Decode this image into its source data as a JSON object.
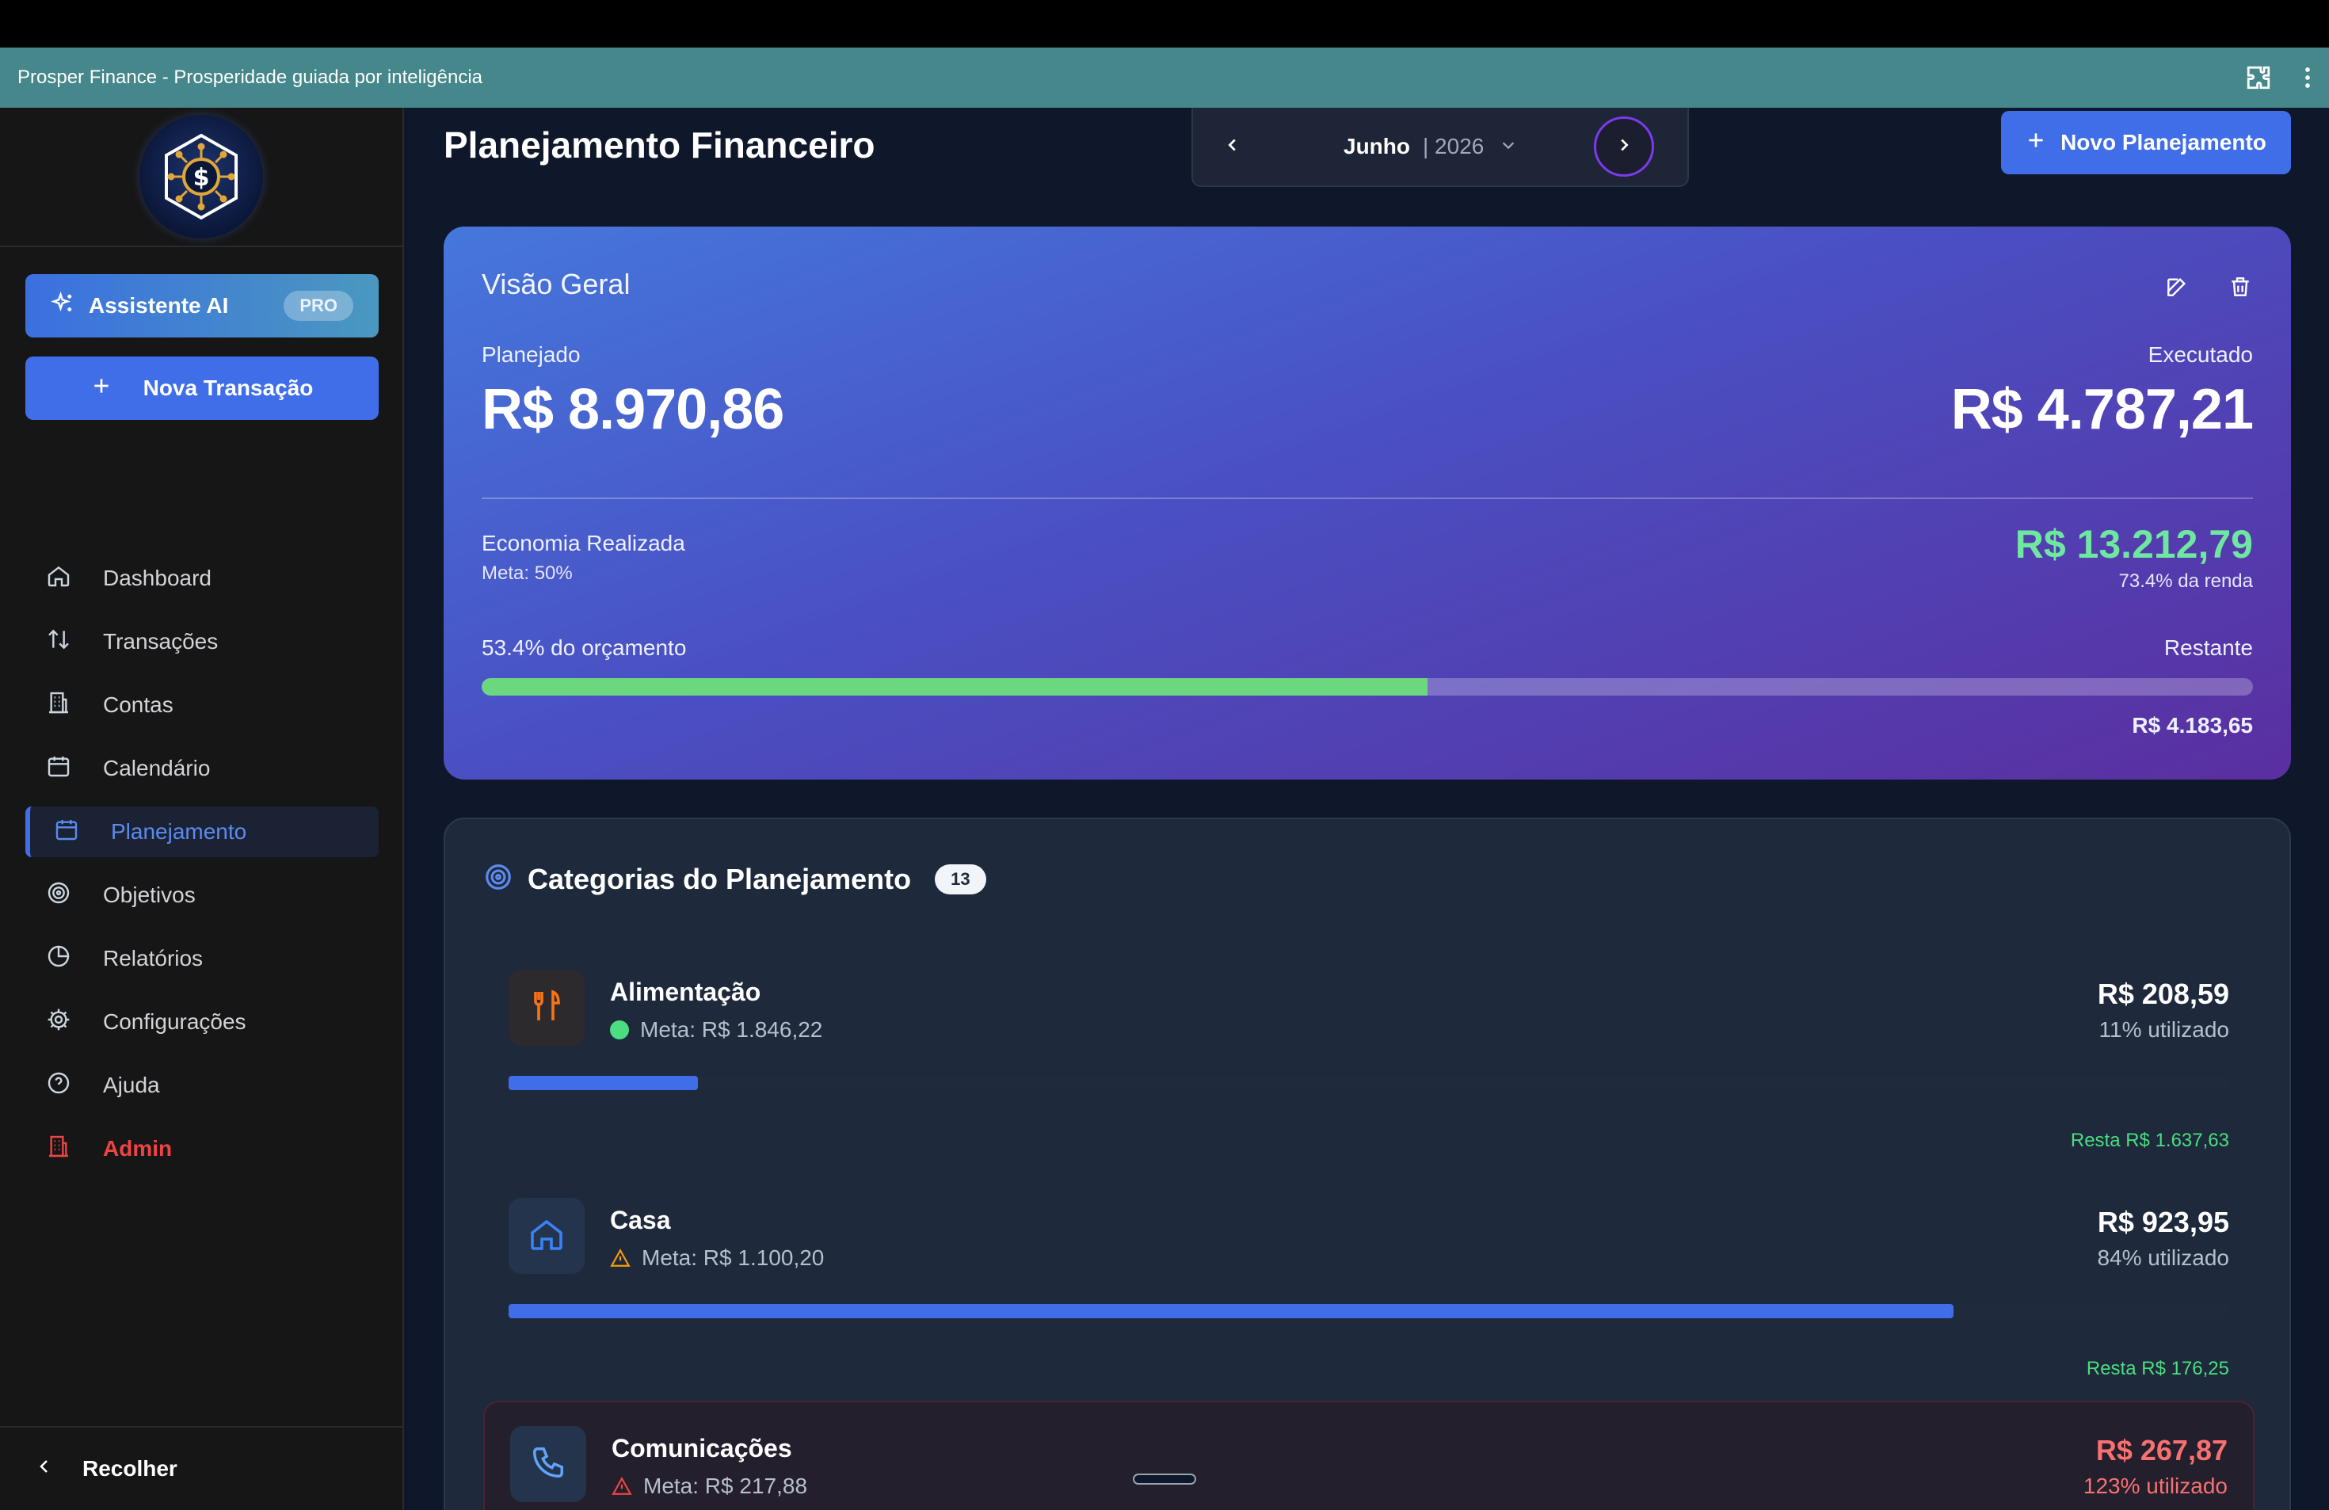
{
  "app": {
    "window_title": "Prosper Finance - Prosperidade guiada por inteligência"
  },
  "sidebar": {
    "ai_button": {
      "label": "Assistente AI",
      "badge": "PRO"
    },
    "new_transaction": {
      "label": "Nova Transação"
    },
    "items": [
      {
        "label": "Dashboard",
        "icon": "home-icon"
      },
      {
        "label": "Transações",
        "icon": "arrows-up-down-icon"
      },
      {
        "label": "Contas",
        "icon": "building-icon"
      },
      {
        "label": "Calendário",
        "icon": "calendar-icon"
      },
      {
        "label": "Planejamento",
        "icon": "calendar-icon",
        "active": true
      },
      {
        "label": "Objetivos",
        "icon": "target-icon"
      },
      {
        "label": "Relatórios",
        "icon": "pie-chart-icon"
      },
      {
        "label": "Configurações",
        "icon": "gear-icon"
      },
      {
        "label": "Ajuda",
        "icon": "help-circle-icon"
      },
      {
        "label": "Admin",
        "icon": "building-icon"
      }
    ],
    "collapse": {
      "label": "Recolher"
    }
  },
  "header": {
    "title": "Planejamento Financeiro",
    "period": {
      "month": "Junho",
      "year": "| 2026"
    },
    "new_plan_label": "Novo Planejamento"
  },
  "overview": {
    "title": "Visão Geral",
    "planned_label": "Planejado",
    "planned_value": "R$ 8.970,86",
    "executed_label": "Executado",
    "executed_value": "R$ 4.787,21",
    "savings_label": "Economia Realizada",
    "savings_goal": "Meta: 50%",
    "savings_value": "R$ 13.212,79",
    "savings_income_pct": "73.4% da renda",
    "budget_pct_label": "53.4% do orçamento",
    "budget_pct": 53.4,
    "remaining_label": "Restante",
    "remaining_value": "R$ 4.183,65"
  },
  "categories": {
    "title": "Categorias do Planejamento",
    "count": "13",
    "items": [
      {
        "name": "Alimentação",
        "meta": "Meta: R$ 1.846,22",
        "status": "ok",
        "amount": "R$ 208,59",
        "used": "11% utilizado",
        "used_pct": 11,
        "rest": "Resta R$ 1.637,63",
        "icon": "fork-knife-icon",
        "icon_color": "#f97316"
      },
      {
        "name": "Casa",
        "meta": "Meta: R$ 1.100,20",
        "status": "warning",
        "amount": "R$ 923,95",
        "used": "84% utilizado",
        "used_pct": 84,
        "rest": "Resta R$ 176,25",
        "icon": "house-icon",
        "icon_color": "#3b82f6"
      },
      {
        "name": "Comunicações",
        "meta": "Meta: R$ 217,88",
        "status": "over",
        "amount": "R$ 267,87",
        "used": "123% utilizado",
        "used_pct": 123,
        "icon": "phone-icon",
        "icon_color": "#60a5fa"
      }
    ]
  },
  "colors": {
    "accent": "#3f6ee8",
    "success": "#4ade80",
    "danger": "#f87171",
    "warning": "#f59e0b"
  }
}
